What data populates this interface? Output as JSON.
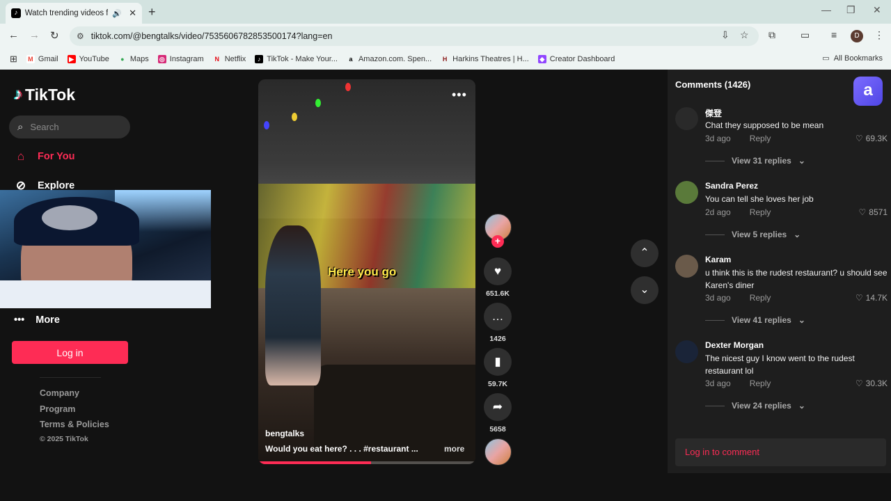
{
  "browser": {
    "tab_title": "Watch trending videos for y",
    "tab_favicon": "♪",
    "url": "tiktok.com/@bengtalks/video/7535606782853500174?lang=en",
    "avatar_letter": "D",
    "bookmarks": [
      {
        "label": "Gmail",
        "icon": "gmail-icon",
        "color": "#ea4335",
        "glyph": "M"
      },
      {
        "label": "YouTube",
        "icon": "youtube-icon",
        "color": "#ff0000",
        "glyph": "▶"
      },
      {
        "label": "Maps",
        "icon": "maps-icon",
        "color": "#34a853",
        "glyph": "●"
      },
      {
        "label": "Instagram",
        "icon": "instagram-icon",
        "color": "#d62976",
        "glyph": "◎"
      },
      {
        "label": "Netflix",
        "icon": "netflix-icon",
        "color": "#e50914",
        "glyph": "N"
      },
      {
        "label": "TikTok - Make Your...",
        "icon": "tiktok-icon",
        "color": "#000000",
        "glyph": "♪"
      },
      {
        "label": "Amazon.com. Spen...",
        "icon": "amazon-icon",
        "color": "#ffffff",
        "glyph": "a"
      },
      {
        "label": "Harkins Theatres | H...",
        "icon": "harkins-icon",
        "color": "#8b1a1a",
        "glyph": "H"
      },
      {
        "label": "Creator Dashboard",
        "icon": "twitch-icon",
        "color": "#9146ff",
        "glyph": "◆"
      }
    ],
    "all_bookmarks": "All Bookmarks"
  },
  "sidebar": {
    "logo": "TikTok",
    "search_placeholder": "Search",
    "nav": [
      {
        "label": "For You",
        "icon": "home-icon",
        "glyph": "⌂"
      },
      {
        "label": "Explore",
        "icon": "compass-icon",
        "glyph": "⊘"
      }
    ],
    "more_label": "More",
    "login_label": "Log in",
    "footer": [
      "Company",
      "Program",
      "Terms & Policies"
    ],
    "copyright": "© 2025 TikTok"
  },
  "video": {
    "caption_overlay": "Here you go",
    "author": "bengtalks",
    "description": "Would you eat here? . . . #restaurant  ...",
    "more": "more",
    "progress": 0.52
  },
  "actions": {
    "likes": "651.6K",
    "comments": "1426",
    "saves": "59.7K",
    "shares": "5658"
  },
  "comments": {
    "title": "Comments (1426)",
    "badge": "a",
    "reply_label": "Reply",
    "items": [
      {
        "name": "傑登",
        "text": "Chat they supposed to be mean",
        "time": "3d ago",
        "likes": "69.3K",
        "replies": "View 31 replies",
        "avatar_color": "#2a2a2a"
      },
      {
        "name": "Sandra Perez",
        "text": "You can tell she loves her job",
        "time": "2d ago",
        "likes": "8571",
        "replies": "View 5 replies",
        "avatar_color": "#5a7a3a"
      },
      {
        "name": "Karam",
        "text": "u think this is the rudest restaurant? u should see Karen's diner",
        "time": "3d ago",
        "likes": "14.7K",
        "replies": "View 41 replies",
        "avatar_color": "#6a5a4a"
      },
      {
        "name": "Dexter Morgan",
        "text": "The nicest guy I know went to the rudest restaurant lol",
        "time": "3d ago",
        "likes": "30.3K",
        "replies": "View 24 replies",
        "avatar_color": "#1a2438"
      }
    ],
    "input_placeholder": "Log in to comment"
  }
}
